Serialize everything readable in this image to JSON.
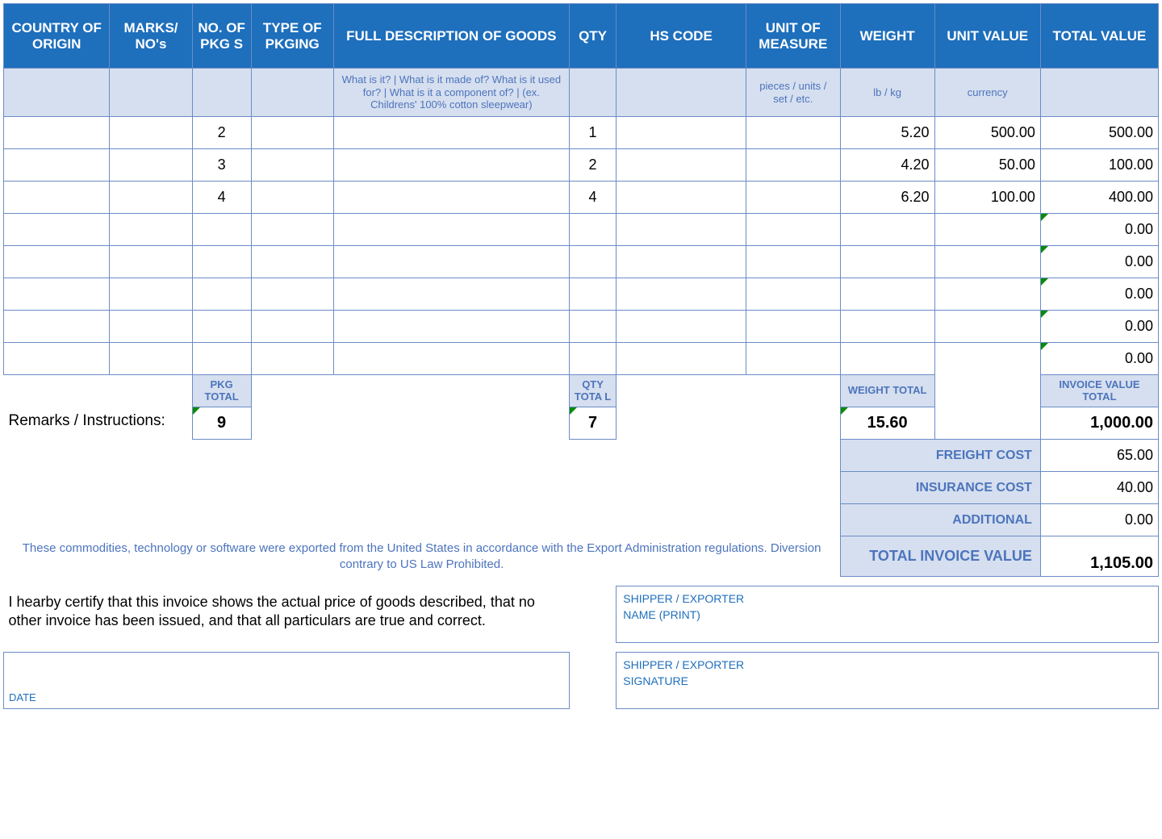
{
  "headers": {
    "country": "COUNTRY OF ORIGIN",
    "marks": "MARKS/ NO's",
    "pkgs": "NO. OF PKG S",
    "pkging": "TYPE OF PKGING",
    "desc": "FULL DESCRIPTION OF GOODS",
    "qty": "QTY",
    "hs": "HS CODE",
    "uom": "UNIT OF MEASURE",
    "weight": "WEIGHT",
    "uval": "UNIT VALUE",
    "tval": "TOTAL VALUE"
  },
  "hints": {
    "desc": "What is it? | What is it made of? What is it used for? | What is it a component of? | (ex. Childrens' 100% cotton sleepwear)",
    "uom": "pieces / units / set / etc.",
    "weight": "lb / kg",
    "uval": "currency"
  },
  "rows": [
    {
      "pkgs": "2",
      "qty": "1",
      "weight": "5.20",
      "uval": "500.00",
      "tval": "500.00"
    },
    {
      "pkgs": "3",
      "qty": "2",
      "weight": "4.20",
      "uval": "50.00",
      "tval": "100.00"
    },
    {
      "pkgs": "4",
      "qty": "4",
      "weight": "6.20",
      "uval": "100.00",
      "tval": "400.00"
    },
    {
      "tval": "0.00"
    },
    {
      "tval": "0.00"
    },
    {
      "tval": "0.00"
    },
    {
      "tval": "0.00"
    },
    {
      "tval": "0.00"
    }
  ],
  "totals_labels": {
    "pkg": "PKG TOTAL",
    "qty": "QTY TOTA L",
    "weight": "WEIGHT TOTAL",
    "invoice_val": "INVOICE VALUE TOTAL"
  },
  "totals": {
    "pkg": "9",
    "qty": "7",
    "weight": "15.60",
    "invoice_val": "1,000.00"
  },
  "remarks_label": "Remarks / Instructions:",
  "charges": {
    "freight_label": "FREIGHT COST",
    "freight": "65.00",
    "insurance_label": "INSURANCE COST",
    "insurance": "40.00",
    "additional_label": "ADDITIONAL",
    "additional": "0.00",
    "total_label": "TOTAL INVOICE VALUE",
    "total": "1,105.00"
  },
  "compliance": "These commodities, technology or software were exported from the United States in accordance with the Export Administration regulations.  Diversion contrary to US Law Prohibited.",
  "certify": "I hearby certify that this invoice shows the actual price of goods described, that no other invoice has been issued, and that all particulars are true and correct.",
  "sig": {
    "name_l1": "SHIPPER / EXPORTER",
    "name_l2": "NAME (PRINT)",
    "sig_l1": "SHIPPER / EXPORTER",
    "sig_l2": "SIGNATURE",
    "date": "DATE"
  }
}
